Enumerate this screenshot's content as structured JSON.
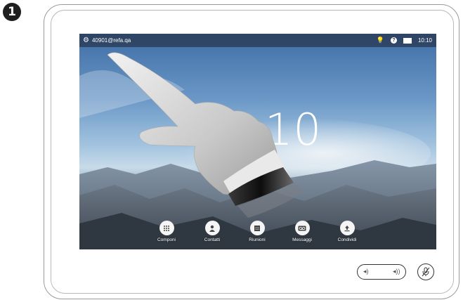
{
  "step_number": "1",
  "statusbar": {
    "address": "40901@refa.qa",
    "time": "10:10",
    "icons": [
      "gear-icon",
      "lightbulb-icon",
      "help-icon",
      "selfview-icon"
    ]
  },
  "clock": {
    "visible_text": "10"
  },
  "apps": [
    {
      "label": "Componi",
      "icon": "keypad-icon"
    },
    {
      "label": "Contatti",
      "icon": "contacts-icon"
    },
    {
      "label": "Riunioni",
      "icon": "calendar-icon"
    },
    {
      "label": "Messaggi",
      "icon": "voicemail-icon"
    },
    {
      "label": "Condividi",
      "icon": "share-icon"
    }
  ],
  "controls": {
    "volume_icons": [
      "volume-down-icon",
      "volume-up-icon"
    ],
    "mute_icon": "microphone-mute-icon"
  },
  "colors": {
    "statusbar_bg": "#283750",
    "app_button_bg": "#f5f5f5",
    "badge_bg": "#1f1f1f"
  }
}
